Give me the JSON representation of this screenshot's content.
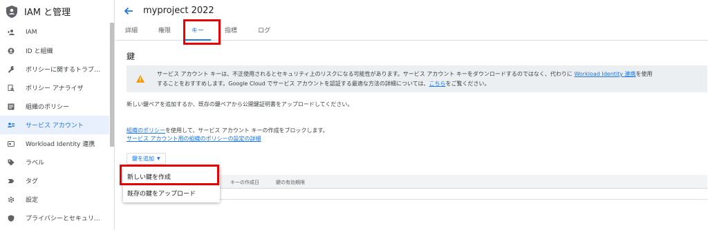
{
  "app": {
    "title": "IAM と管理"
  },
  "sidebar": {
    "items": [
      {
        "label": "IAM",
        "icon": "person-add-icon"
      },
      {
        "label": "ID と組織",
        "icon": "account-circle-icon"
      },
      {
        "label": "ポリシーに関するトラブ…",
        "icon": "wrench-icon"
      },
      {
        "label": "ポリシー アナライザ",
        "icon": "document-search-icon"
      },
      {
        "label": "組織のポリシー",
        "icon": "list-icon"
      },
      {
        "label": "サービス アカウント",
        "icon": "service-account-icon",
        "active": true
      },
      {
        "label": "Workload Identity 連携",
        "icon": "card-icon"
      },
      {
        "label": "ラベル",
        "icon": "tag-icon"
      },
      {
        "label": "タグ",
        "icon": "label-arrow-icon"
      },
      {
        "label": "設定",
        "icon": "gear-icon"
      },
      {
        "label": "プライバシーとセキュリ…",
        "icon": "shield-icon"
      }
    ]
  },
  "header": {
    "project_title": "myproject 2022"
  },
  "tabs": [
    {
      "label": "詳細"
    },
    {
      "label": "権限"
    },
    {
      "label": "キー",
      "active": true
    },
    {
      "label": "指標"
    },
    {
      "label": "ログ"
    }
  ],
  "main": {
    "section_title": "鍵",
    "warning": {
      "text_1": "サービス アカウント キーは、不正使用されるとセキュリティ上のリスクになる可能性があります。サービス アカウント キーをダウンロードするのではなく、代わりに ",
      "link_1": "Workload Identity 連携",
      "text_2": "を使用",
      "text_3": "することをおすすめします。Google Cloud でサービス アカウントを認証する最適な方法の詳細については、",
      "link_2": "こちら",
      "text_4": "をご覧ください。"
    },
    "description": "新しい鍵ペアを追加するか、既存の鍵ペアから公開鍵証明書をアップロードしてください。",
    "policy": {
      "link_1": "組織のポリシー",
      "text_1": "を使用して、サービス アカウント キーの作成をブロックします。",
      "link_2": "サービス アカウント用の組織のポリシーの設定の詳細"
    },
    "add_key_label": "鍵を追加",
    "table_headers": [
      "キーの作成日",
      "鍵の有効期限"
    ],
    "menu": [
      {
        "label": "新しい鍵を作成"
      },
      {
        "label": "既存の鍵をアップロード"
      }
    ]
  },
  "colors": {
    "accent": "#1a73e8",
    "highlight": "#ea0000",
    "warning": "#f29900"
  }
}
